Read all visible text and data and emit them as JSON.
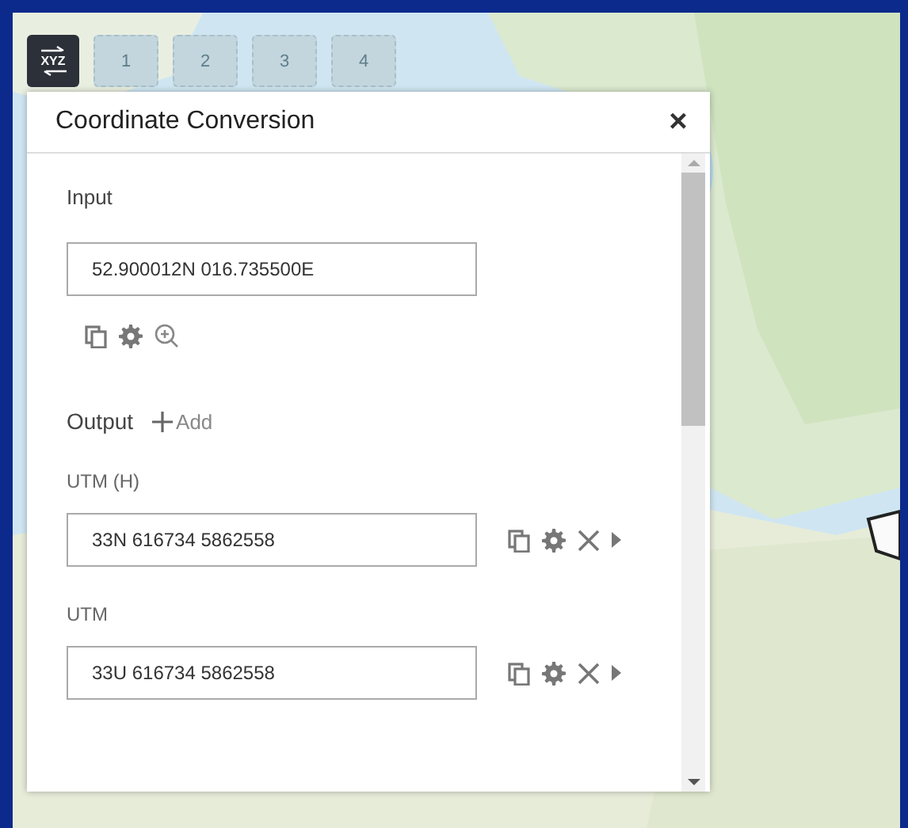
{
  "toolbar": {
    "main_button": {
      "label": "XYZ",
      "selected": true
    },
    "slots": [
      {
        "label": "1",
        "disabled": true
      },
      {
        "label": "2",
        "disabled": true
      },
      {
        "label": "3",
        "disabled": true
      },
      {
        "label": "4",
        "disabled": true
      }
    ]
  },
  "panel": {
    "title": "Coordinate Conversion",
    "close": "×",
    "input": {
      "label": "Input",
      "value": "52.900012N 016.735500E"
    },
    "output": {
      "label": "Output",
      "add": "Add",
      "rows": [
        {
          "label": "UTM (H)",
          "value": "33N 616734 5862558"
        },
        {
          "label": "UTM",
          "value": "33U 616734 5862558"
        }
      ]
    }
  }
}
